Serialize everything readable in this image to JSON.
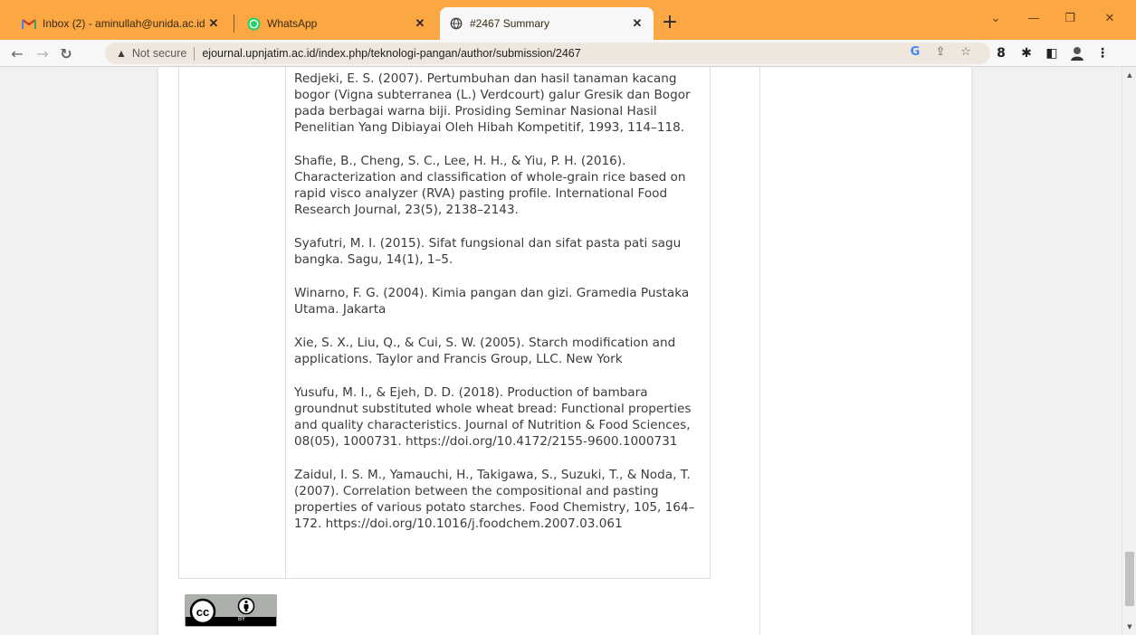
{
  "tabs": [
    {
      "title": "Inbox (2) - aminullah@unida.ac.id",
      "icon": "gmail-icon"
    },
    {
      "title": "WhatsApp",
      "icon": "whatsapp-icon"
    },
    {
      "title": "#2467 Summary",
      "icon": "globe-icon",
      "active": true
    }
  ],
  "toolbar": {
    "security_label": "Not secure",
    "url": "ejournal.upnjatim.ac.id/index.php/teknologi-pangan/author/submission/2467"
  },
  "references": [
    "Redjeki, E. S. (2007). Pertumbuhan dan hasil tanaman kacang bogor (Vigna subterranea (L.) Verdcourt) galur Gresik dan Bogor pada berbagai warna biji. Prosiding Seminar Nasional Hasil Penelitian Yang Dibiayai Oleh Hibah Kompetitif, 1993, 114–118.",
    "Shafie, B., Cheng, S. C., Lee, H. H., & Yiu, P. H. (2016). Characterization and classification of whole-grain rice based on rapid visco analyzer (RVA) pasting profile. International Food Research Journal, 23(5), 2138–2143.",
    "Syafutri, M. I. (2015). Sifat fungsional dan sifat pasta pati sagu bangka. Sagu, 14(1), 1–5.",
    "Winarno, F. G. (2004). Kimia pangan dan gizi. Gramedia Pustaka Utama. Jakarta",
    "Xie, S. X., Liu, Q., & Cui, S. W. (2005). Starch modification and applications. Taylor and Francis Group, LLC. New York",
    "Yusufu, M. I., & Ejeh, D. D. (2018). Production of bambara groundnut substituted whole wheat bread: Functional properties and quality characteristics. Journal of Nutrition & Food Sciences, 08(05), 1000731. https://doi.org/10.4172/2155-9600.1000731",
    "Zaidul, I. S. M., Yamauchi, H., Takigawa, S., Suzuki, T., & Noda, T. (2007). Correlation between the compositional and pasting properties of various potato starches. Food Chemistry, 105, 164–172. https://doi.org/10.1016/j.foodchem.2007.03.061"
  ],
  "license": {
    "badge_text": "BY",
    "icon": "creative-commons-icon"
  },
  "colors": {
    "tabbar": "#fba744",
    "page": "#ffffff",
    "text": "#3b3b3b"
  }
}
